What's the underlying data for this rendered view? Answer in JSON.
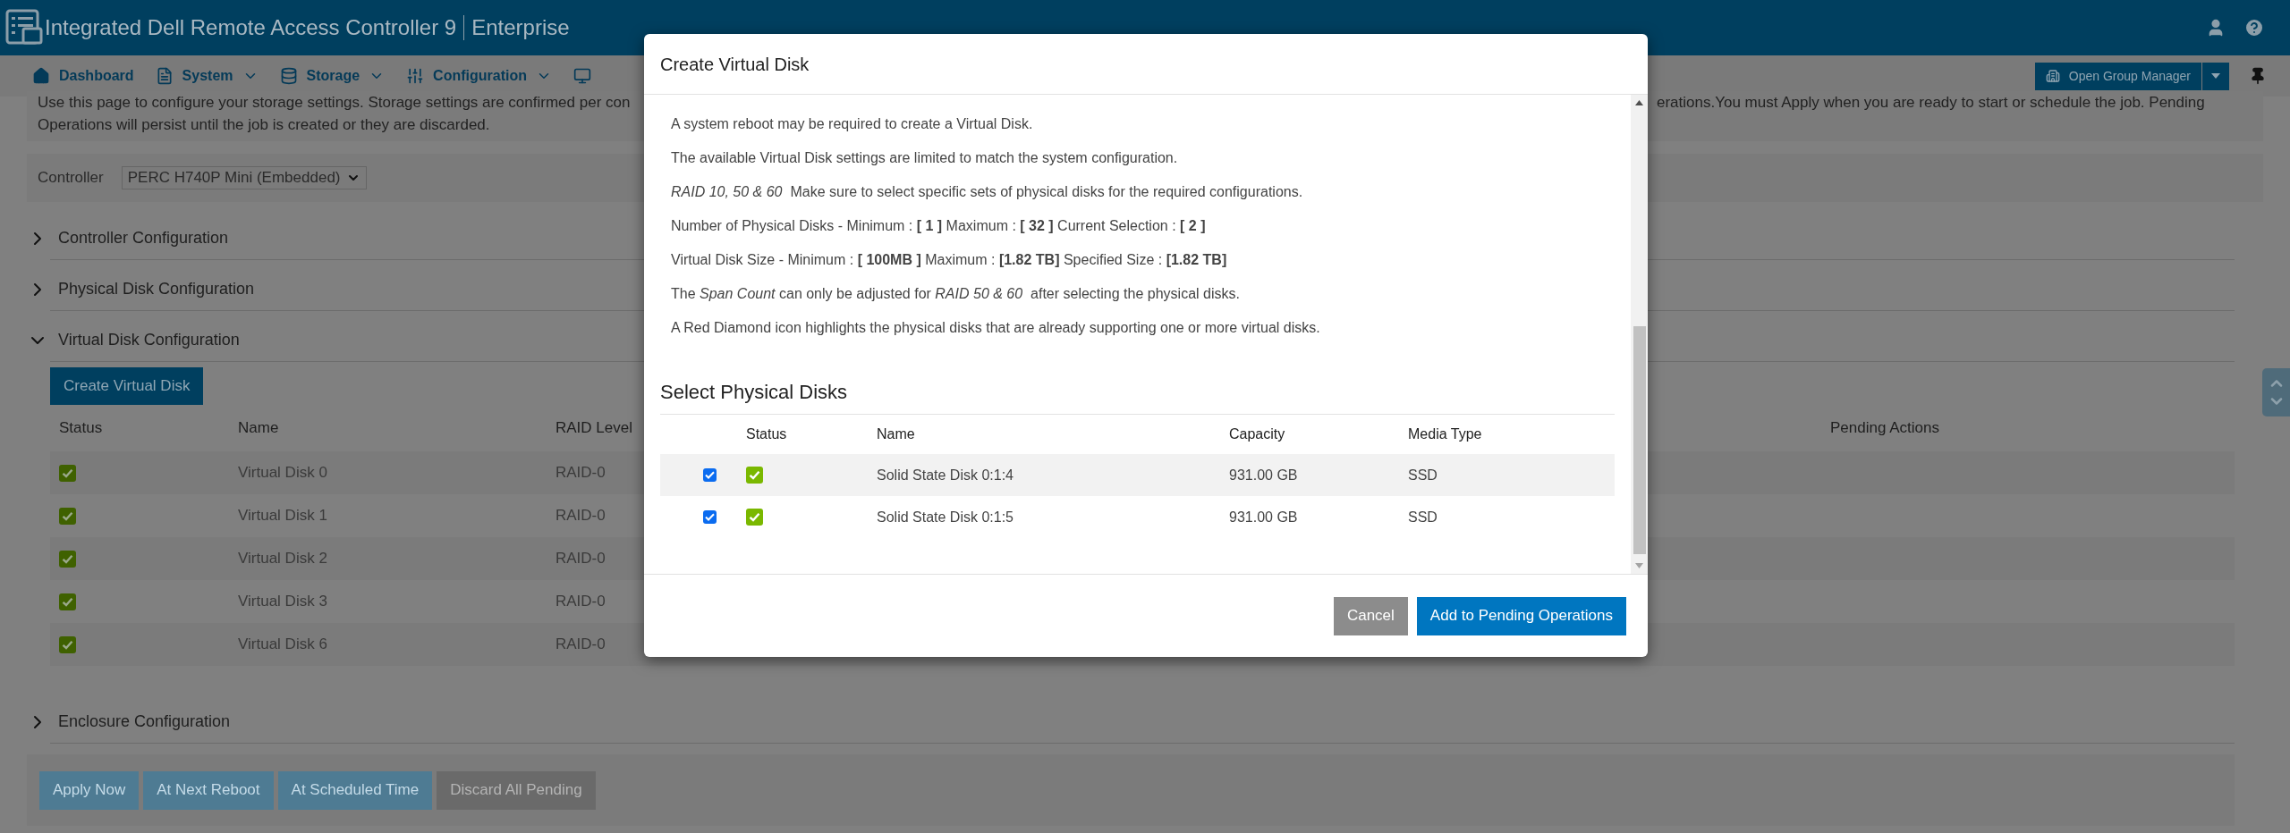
{
  "header": {
    "title": "Integrated Dell Remote Access Controller 9",
    "edition": "Enterprise"
  },
  "nav": {
    "items": [
      {
        "label": "Dashboard",
        "has_menu": false
      },
      {
        "label": "System",
        "has_menu": true
      },
      {
        "label": "Storage",
        "has_menu": true
      },
      {
        "label": "Configuration",
        "has_menu": true
      }
    ],
    "group_manager": "Open Group Manager"
  },
  "intro": {
    "left_lines": [
      "Use this page to configure your storage settings. Storage settings are confirmed per con",
      "Operations will persist until the job is created or they are discarded."
    ],
    "right_line": "erations.You must Apply when you are ready to start or schedule the job. Pending"
  },
  "controller": {
    "label": "Controller",
    "value": "PERC H740P Mini (Embedded)"
  },
  "sections": [
    {
      "label": "Controller Configuration",
      "expanded": false
    },
    {
      "label": "Physical Disk Configuration",
      "expanded": false
    },
    {
      "label": "Virtual Disk Configuration",
      "expanded": true,
      "button": "Create Virtual Disk",
      "columns": [
        "Status",
        "Name",
        "RAID Level",
        "Pending Actions"
      ],
      "rows": [
        {
          "name": "Virtual Disk 0",
          "raid": "RAID-0"
        },
        {
          "name": "Virtual Disk 1",
          "raid": "RAID-0"
        },
        {
          "name": "Virtual Disk 2",
          "raid": "RAID-0"
        },
        {
          "name": "Virtual Disk 3",
          "raid": "RAID-0"
        },
        {
          "name": "Virtual Disk 6",
          "raid": "RAID-0"
        }
      ]
    },
    {
      "label": "Enclosure Configuration",
      "expanded": false
    }
  ],
  "footer_buttons": [
    {
      "label": "Apply Now",
      "disabled": false
    },
    {
      "label": "At Next Reboot",
      "disabled": false
    },
    {
      "label": "At Scheduled Time",
      "disabled": false
    },
    {
      "label": "Discard All Pending",
      "disabled": true
    }
  ],
  "dialog": {
    "title": "Create Virtual Disk",
    "notes": [
      "A system reboot may be required to create a Virtual Disk.",
      "The available Virtual Disk settings are limited to match the system configuration.",
      "*RAID 10, 50 & 60*  Make sure to select specific sets of physical disks for the required configurations.",
      "Number of Physical Disks - Minimum : **[ 1 ]** Maximum : **[ 32 ]** Current Selection : **[ 2 ]**",
      "Virtual Disk Size - Minimum : **[ 100MB ]** Maximum : **[1.82 TB]** Specified Size : **[1.82 TB]**",
      "The *Span Count* can only be adjusted for *RAID 50 & 60*  after selecting the physical disks.",
      "A Red Diamond icon highlights the physical disks that are already supporting one or more virtual disks."
    ],
    "section_title": "Select Physical Disks",
    "columns": [
      "Status",
      "Name",
      "Capacity",
      "Media Type"
    ],
    "disks": [
      {
        "checked": true,
        "name": "Solid State Disk 0:1:4",
        "capacity": "931.00 GB",
        "media_type": "SSD"
      },
      {
        "checked": true,
        "name": "Solid State Disk 0:1:5",
        "capacity": "931.00 GB",
        "media_type": "SSD"
      }
    ],
    "buttons": [
      {
        "label": "Cancel",
        "kind": "secondary"
      },
      {
        "label": "Add to Pending Operations",
        "kind": "primary"
      }
    ]
  }
}
